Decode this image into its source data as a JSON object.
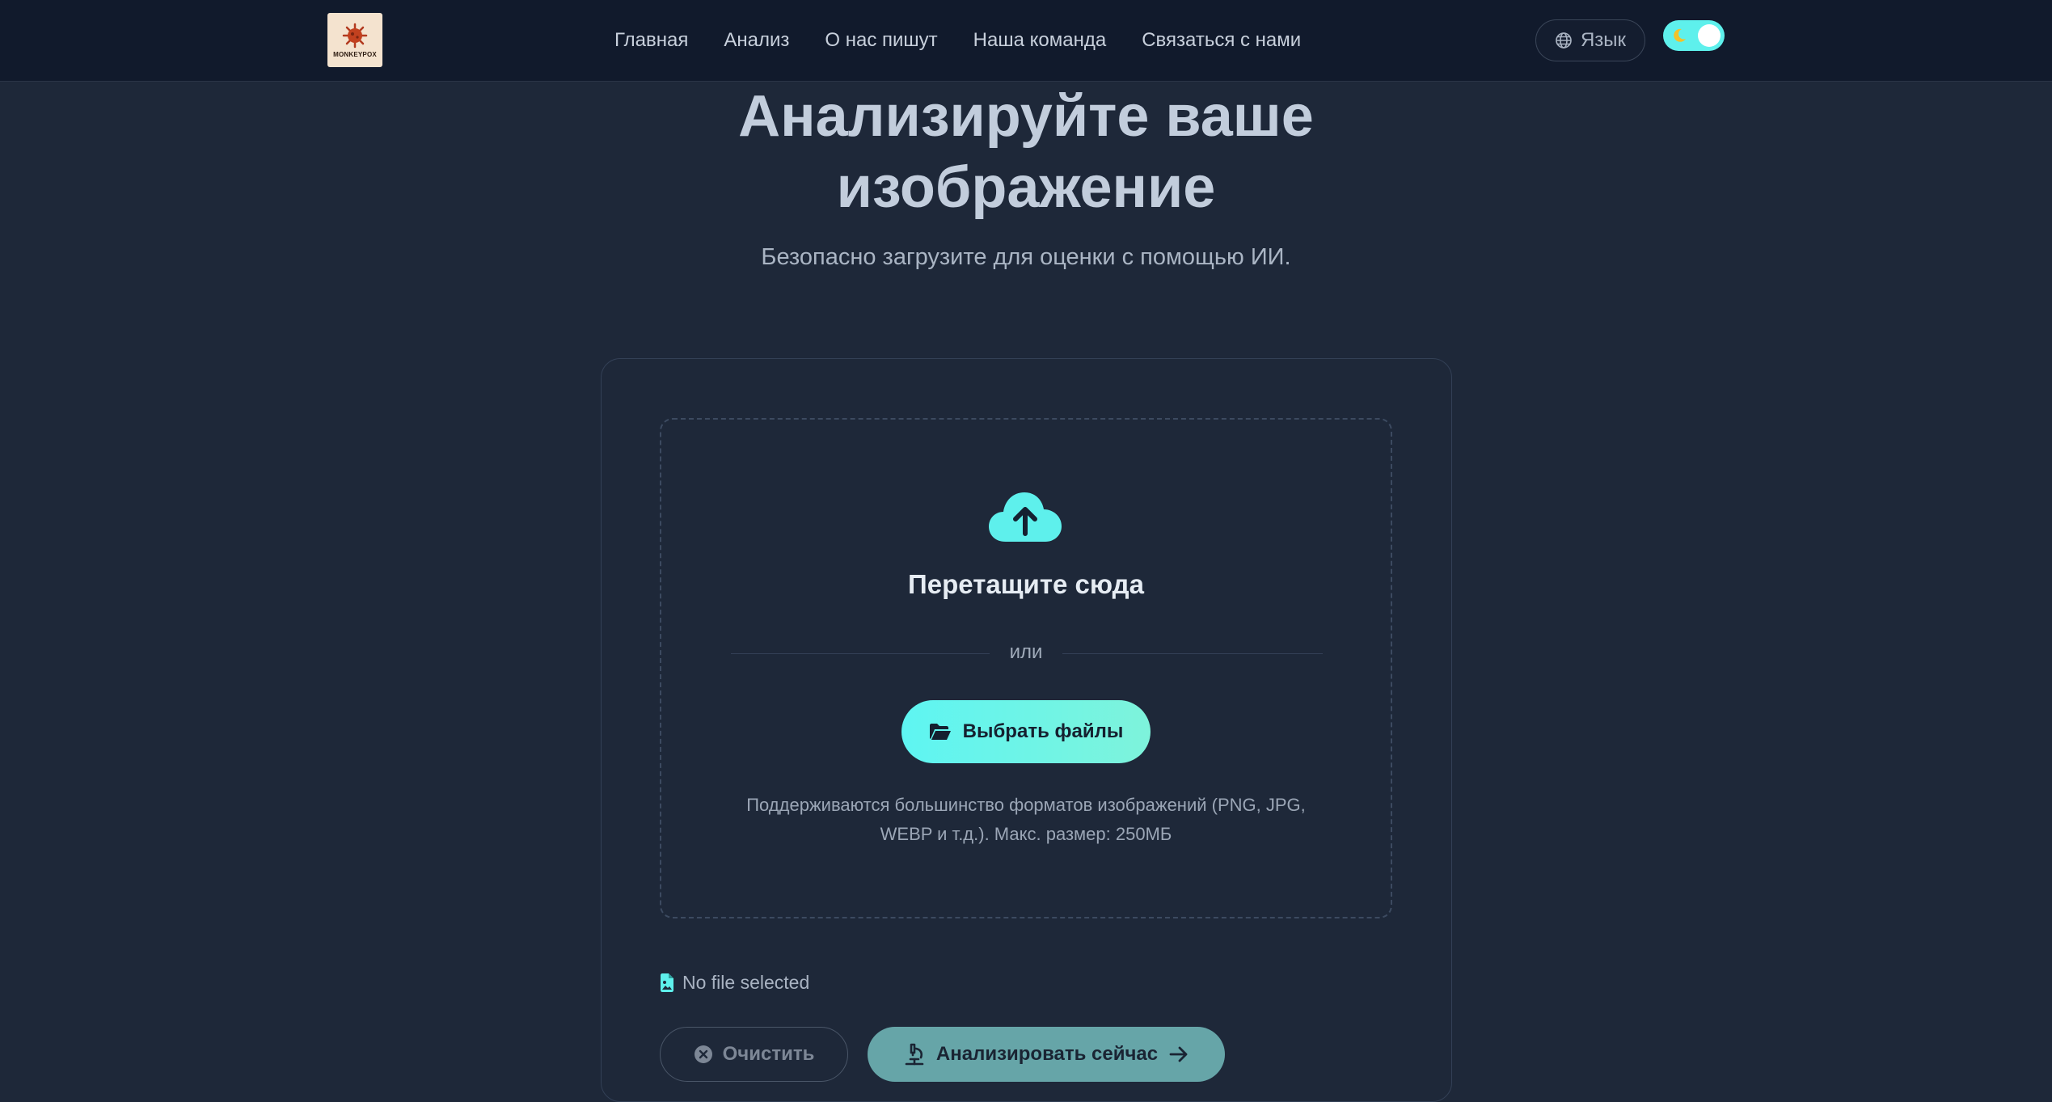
{
  "logo": {
    "text": "MONKEYPOX"
  },
  "nav": {
    "links": [
      "Главная",
      "Анализ",
      "О нас пишут",
      "Наша команда",
      "Связаться с нами"
    ],
    "language_label": "Язык"
  },
  "hero": {
    "title_line1": "Анализируйте ваше",
    "title_line2": "изображение",
    "subtitle": "Безопасно загрузите для оценки с помощью ИИ."
  },
  "upload": {
    "drop_title": "Перетащите сюда",
    "divider_text": "или",
    "choose_button": "Выбрать файлы",
    "formats_line1": "Поддерживаются большинство форматов изображений (PNG, JPG,",
    "formats_line2": "WEBP и т.д.). Макс. размер: 250МБ",
    "file_status": "No file selected",
    "clear_button": "Очистить",
    "analyze_button": "Анализировать сейчас"
  },
  "colors": {
    "accent": "#5ef5f2",
    "background": "#1e2839",
    "navbar": "#111a2c"
  },
  "icons": {
    "logo": "virus-icon",
    "language": "globe-icon",
    "theme": "moon-icon",
    "upload": "cloud-upload-icon",
    "choose": "folder-open-icon",
    "file": "file-image-icon",
    "clear": "circle-x-icon",
    "analyze": "microscope-icon",
    "arrow": "arrow-right-icon"
  }
}
